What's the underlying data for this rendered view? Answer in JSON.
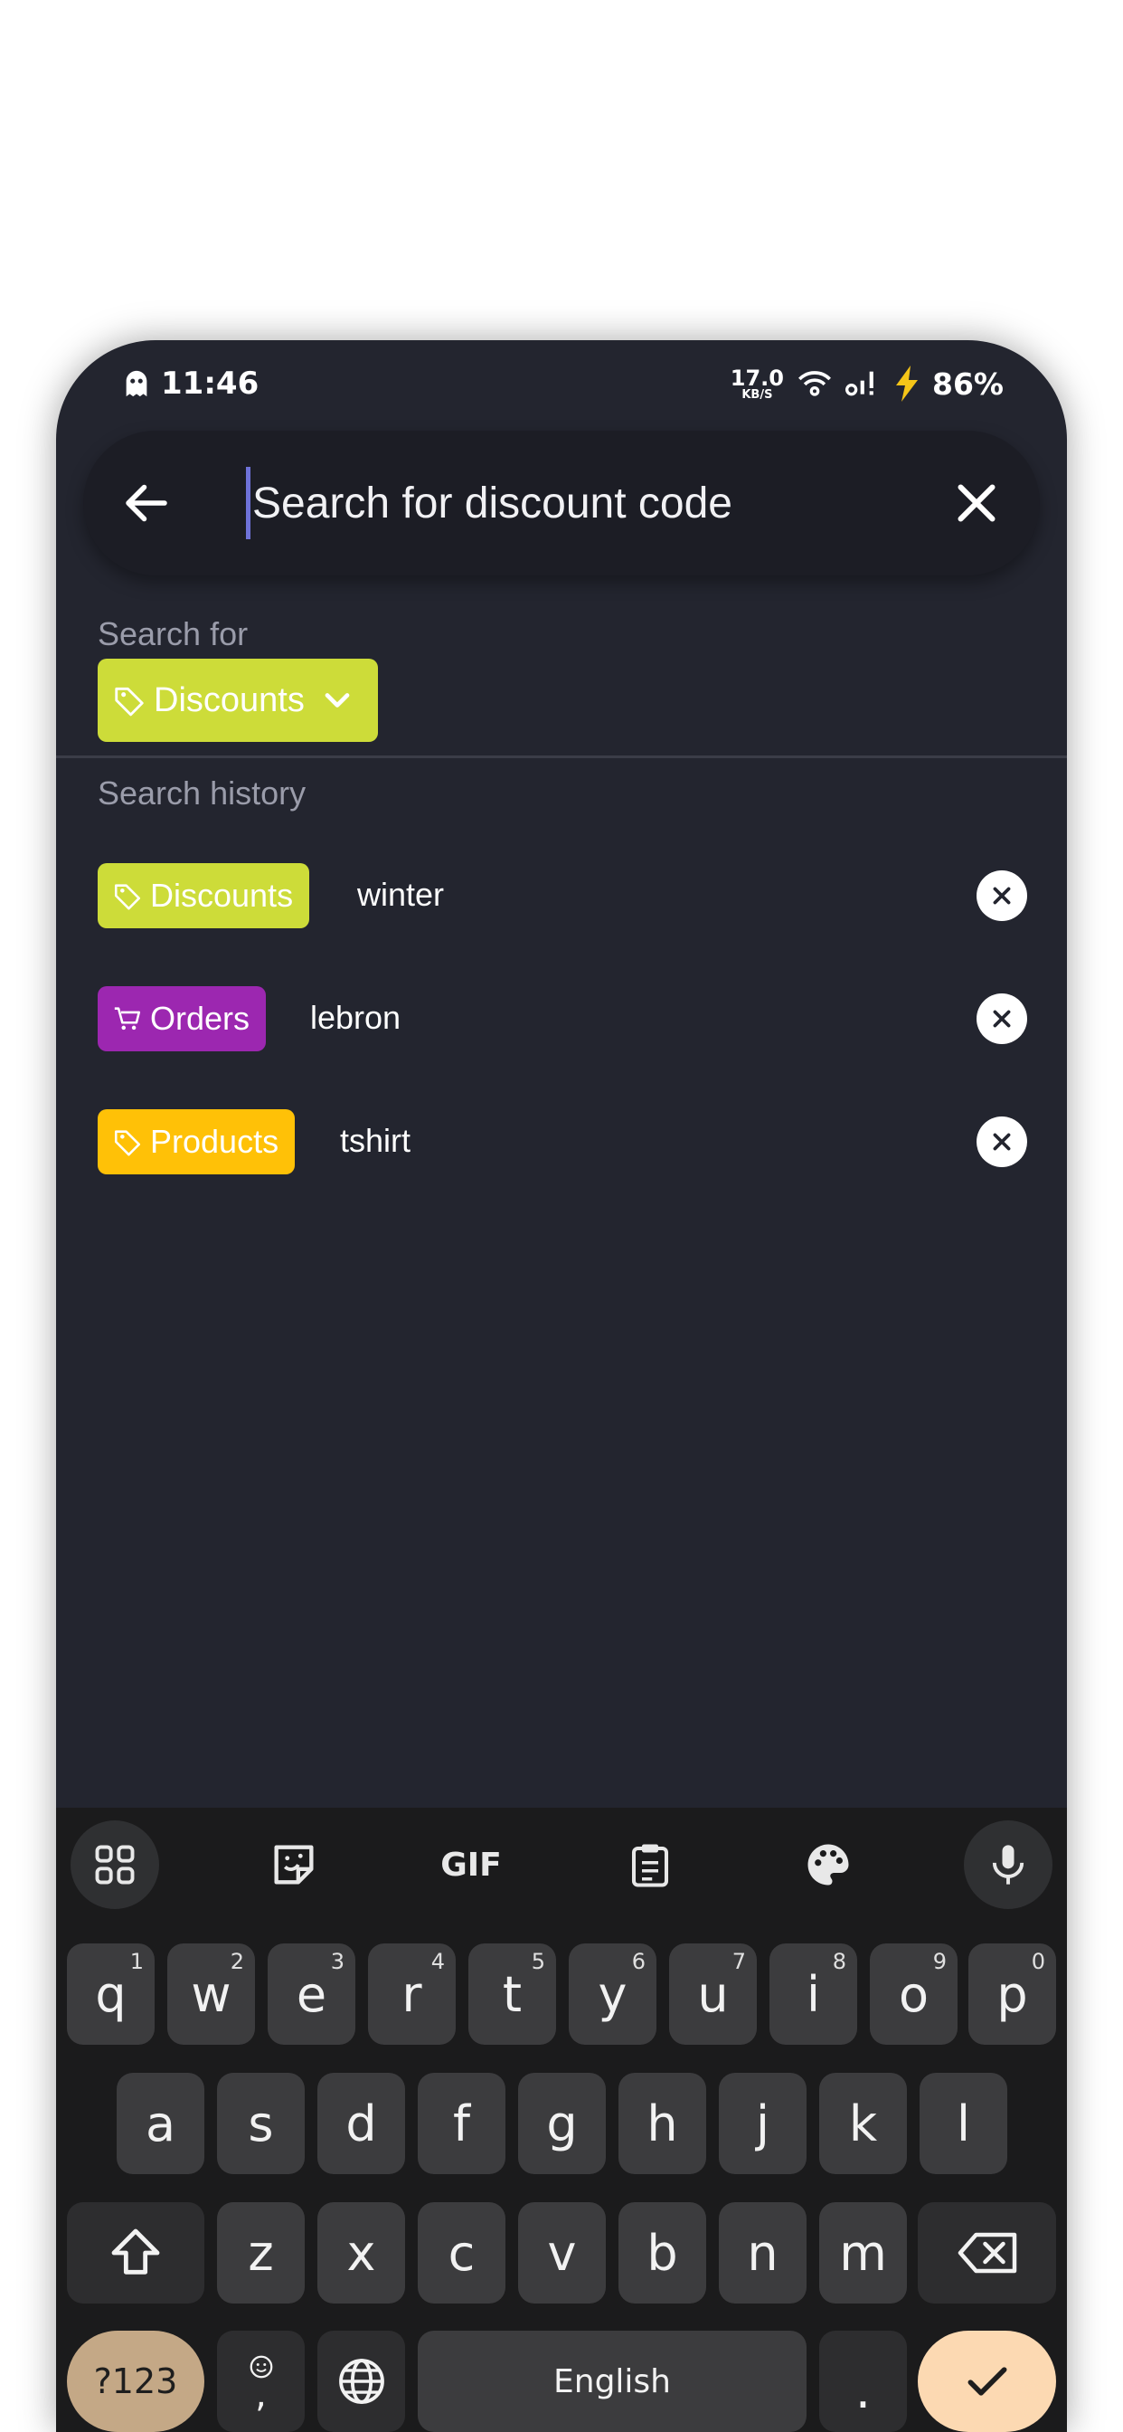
{
  "status_bar": {
    "time": "11:46",
    "net_speed": "17.0",
    "net_unit": "KB/S",
    "battery": "86%"
  },
  "search": {
    "placeholder": "Search for discount code",
    "value": ""
  },
  "search_for": {
    "label": "Search for",
    "selected": "Discounts"
  },
  "history": {
    "label": "Search history",
    "items": [
      {
        "category": "Discounts",
        "query": "winter",
        "color": "#cddc39"
      },
      {
        "category": "Orders",
        "query": "lebron",
        "color": "#9c27b0"
      },
      {
        "category": "Products",
        "query": "tshirt",
        "color": "#ffc107"
      }
    ]
  },
  "keyboard": {
    "toolbar": [
      "apps-icon",
      "sticker-icon",
      "GIF",
      "clipboard-icon",
      "palette-icon",
      "mic-icon"
    ],
    "row1": [
      {
        "k": "q",
        "n": "1"
      },
      {
        "k": "w",
        "n": "2"
      },
      {
        "k": "e",
        "n": "3"
      },
      {
        "k": "r",
        "n": "4"
      },
      {
        "k": "t",
        "n": "5"
      },
      {
        "k": "y",
        "n": "6"
      },
      {
        "k": "u",
        "n": "7"
      },
      {
        "k": "i",
        "n": "8"
      },
      {
        "k": "o",
        "n": "9"
      },
      {
        "k": "p",
        "n": "0"
      }
    ],
    "row2": [
      "a",
      "s",
      "d",
      "f",
      "g",
      "h",
      "j",
      "k",
      "l"
    ],
    "row3": [
      "z",
      "x",
      "c",
      "v",
      "b",
      "n",
      "m"
    ],
    "symbols_label": "?123",
    "comma": ",",
    "space_label": "English",
    "period": "."
  },
  "colors": {
    "background": "#23252f",
    "discounts": "#cddc39",
    "orders": "#9c27b0",
    "products": "#ffc107",
    "enter_key": "#fcd9b2"
  }
}
